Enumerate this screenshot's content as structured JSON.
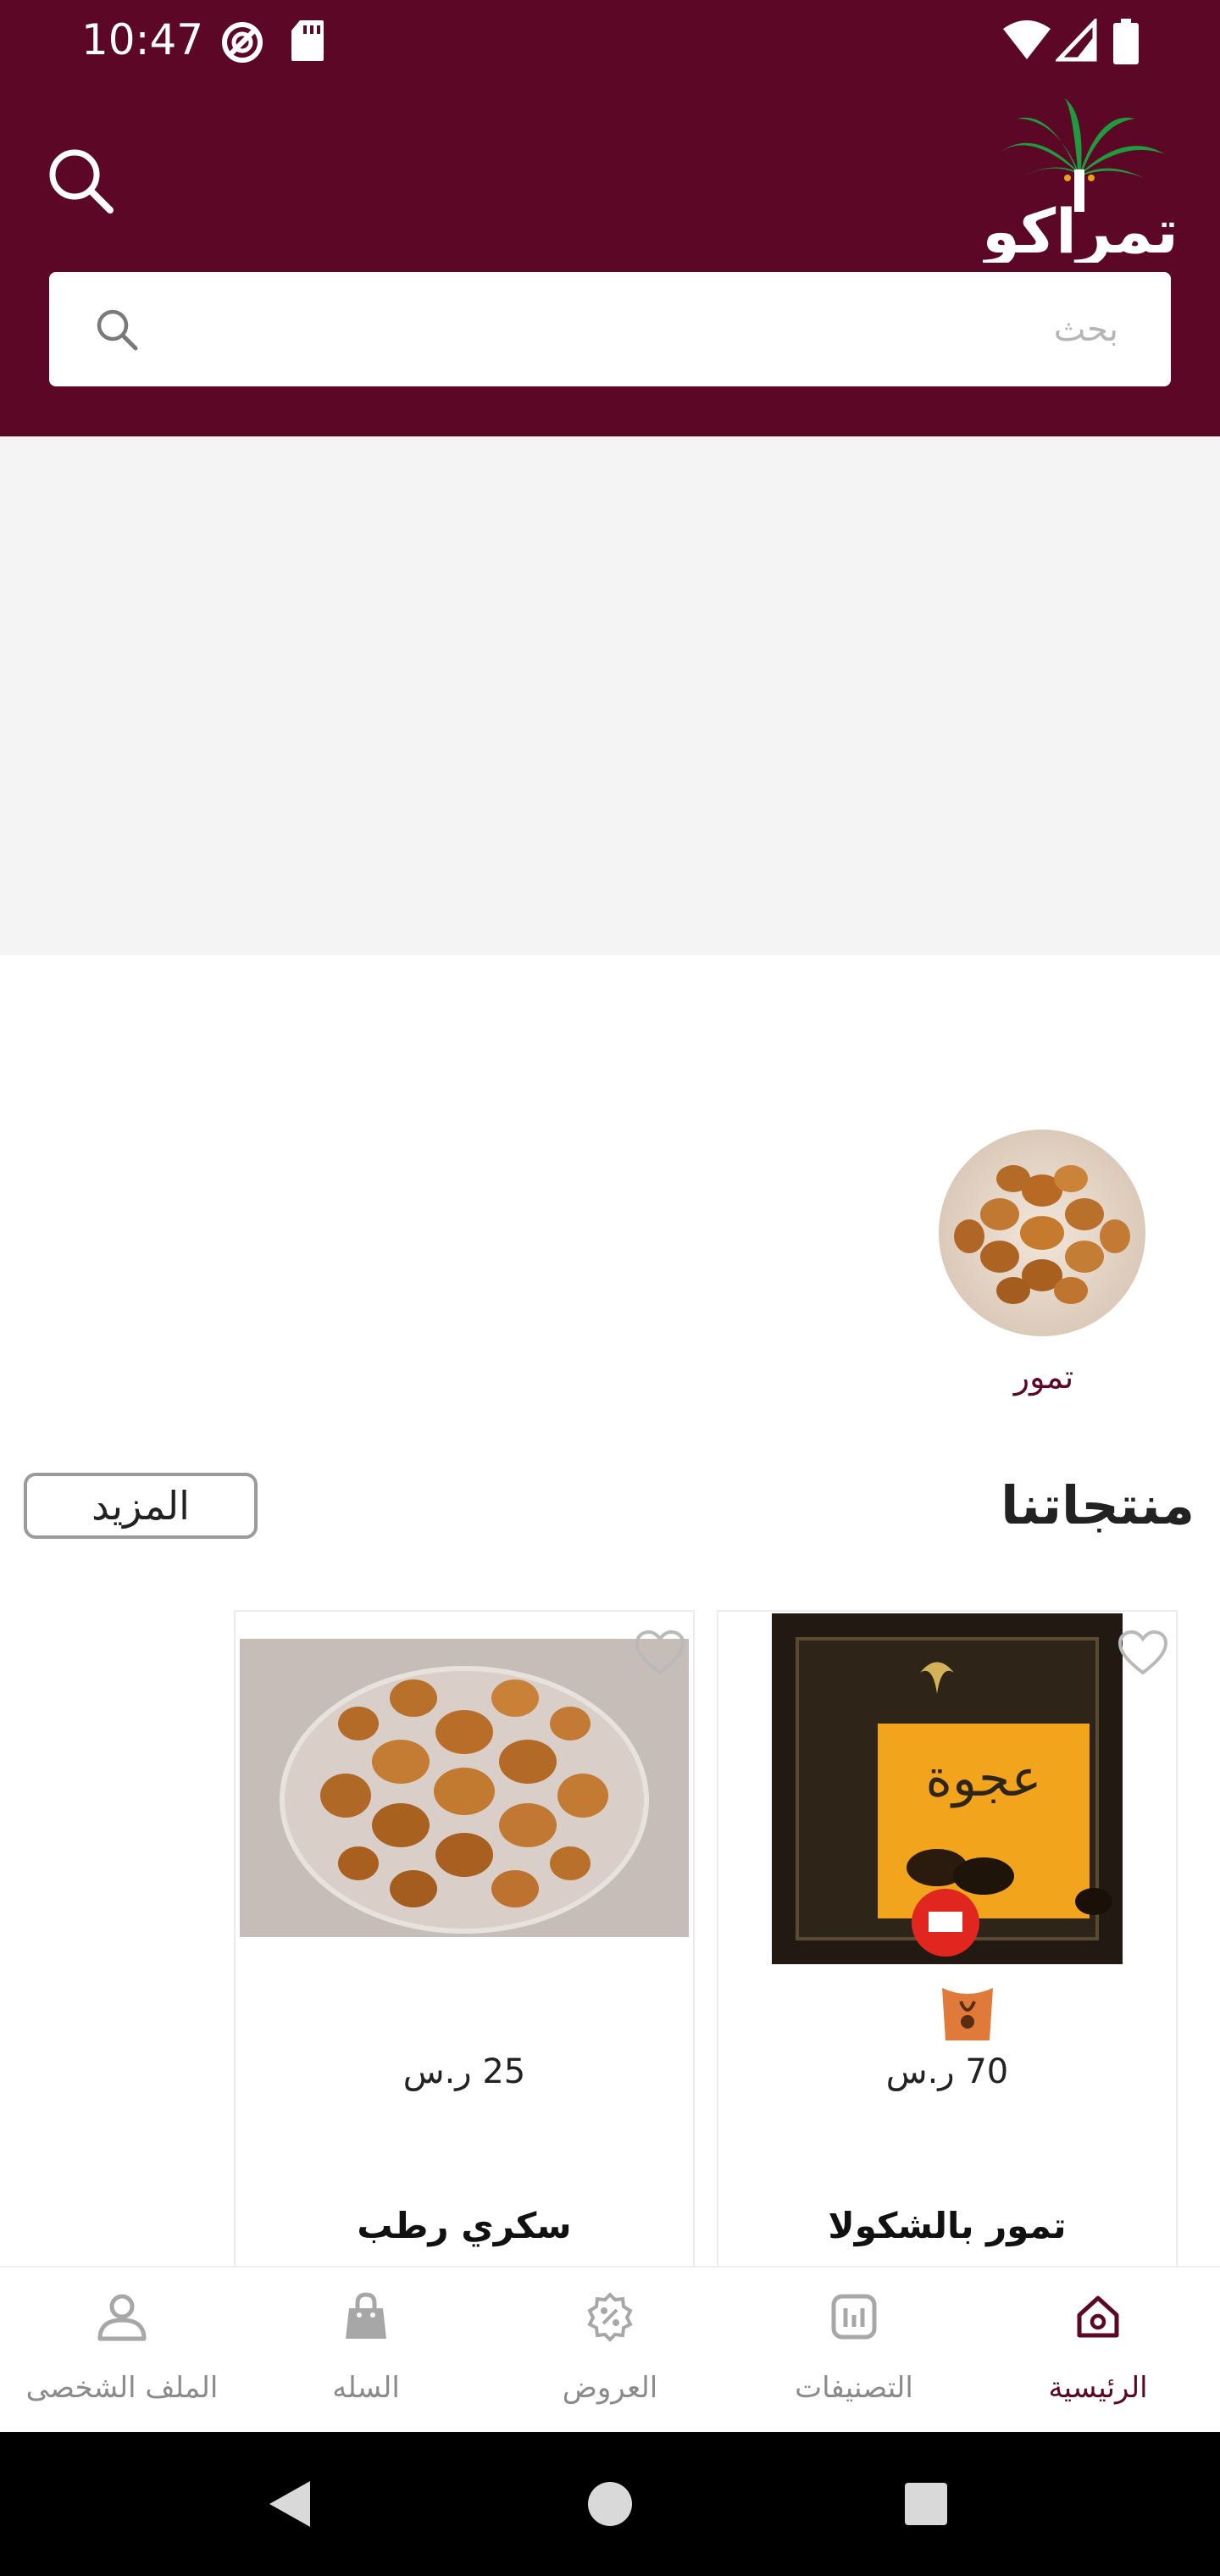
{
  "status_bar": {
    "time": "10:47"
  },
  "header": {
    "logo_text": "تمراكو"
  },
  "search": {
    "placeholder": "بحث"
  },
  "categories": [
    {
      "label": "تمور"
    }
  ],
  "products_section": {
    "title": "منتجاتنا",
    "more_label": "المزيد"
  },
  "products": [
    {
      "name": "تمور بالشكولا",
      "price": "70 ر.س"
    },
    {
      "name": "سكري رطب",
      "price": "25 ر.س"
    }
  ],
  "bottom_nav": [
    {
      "label": "الرئيسية",
      "icon": "home-icon",
      "active": true
    },
    {
      "label": "التصنيفات",
      "icon": "categories-icon",
      "active": false
    },
    {
      "label": "العروض",
      "icon": "offers-icon",
      "active": false
    },
    {
      "label": "السله",
      "icon": "bag-icon",
      "active": false
    },
    {
      "label": "الملف الشخصى",
      "icon": "profile-icon",
      "active": false
    }
  ],
  "colors": {
    "primary": "#5c0726",
    "accent_green": "#1f9b3f"
  }
}
